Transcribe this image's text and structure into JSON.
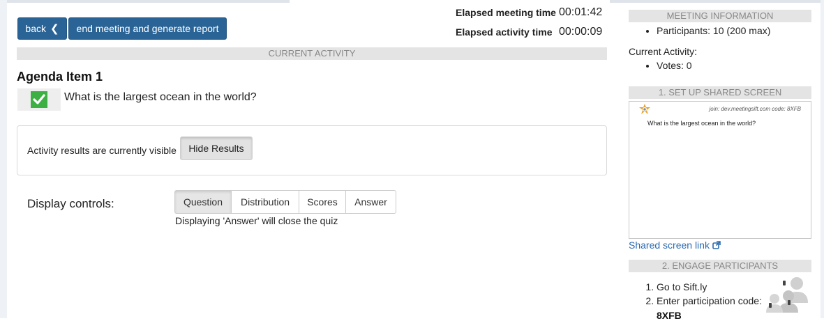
{
  "header": {
    "back_label": "back",
    "end_label": "end meeting and generate report",
    "elapsed_meeting_label": "Elapsed meeting time",
    "elapsed_meeting_value": "00:01:42",
    "elapsed_activity_label": "Elapsed activity time",
    "elapsed_activity_value": "00:00:09"
  },
  "main": {
    "section_title": "CURRENT ACTIVITY",
    "agenda_title": "Agenda Item 1",
    "question": "What is the largest ocean in the world?",
    "results_text": "Activity results are currently visible",
    "hide_results_label": "Hide Results",
    "display_controls_label": "Display controls:",
    "controls": [
      "Question",
      "Distribution",
      "Scores",
      "Answer"
    ],
    "controls_note": "Displaying 'Answer' will close the quiz"
  },
  "sidebar": {
    "meeting_info_title": "MEETING INFORMATION",
    "participants": "Participants: 10 (200 max)",
    "current_activity_label": "Current Activity:",
    "votes": "Votes: 0",
    "setup_title": "1. SET UP SHARED SCREEN",
    "preview_join": "join: dev.meetingsift.com  code: 8XFB",
    "preview_question": "What is the largest ocean in the world?",
    "shared_screen_link": "Shared screen link",
    "engage_title": "2. ENGAGE PARTICIPANTS",
    "step1": "Go to Sift.ly",
    "step2": "Enter participation code:",
    "code": "8XFB"
  },
  "colors": {
    "primary": "#2a6496",
    "check": "#3cb043",
    "link": "#2a6ab0",
    "section_bg": "#e4e4e4"
  }
}
